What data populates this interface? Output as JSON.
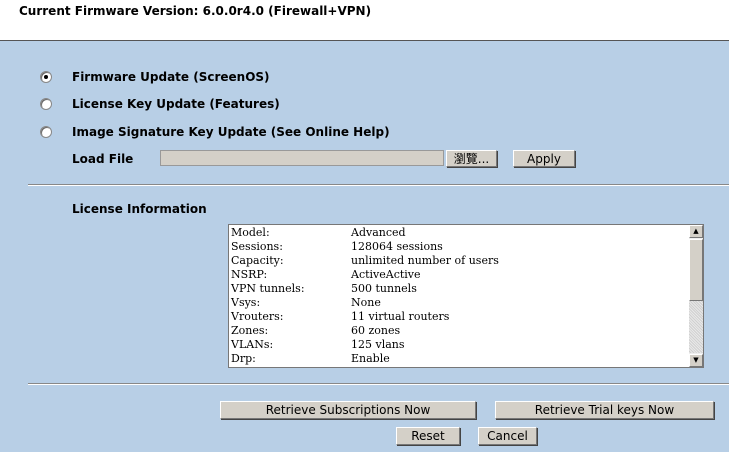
{
  "header": {
    "title": "Current Firmware Version: 6.0.0r4.0 (Firewall+VPN)"
  },
  "update_options": [
    {
      "label": "Firmware Update (ScreenOS)",
      "selected": true
    },
    {
      "label": "License Key Update (Features)",
      "selected": false
    },
    {
      "label": "Image Signature Key Update (See Online Help)",
      "selected": false
    }
  ],
  "load_file": {
    "label": "Load File",
    "value": "",
    "browse_label": "瀏覽...",
    "apply_label": "Apply"
  },
  "license_info": {
    "label": "License Information",
    "rows": [
      {
        "key": "Model:",
        "value": "Advanced"
      },
      {
        "key": "Sessions:",
        "value": "128064 sessions"
      },
      {
        "key": "Capacity:",
        "value": "unlimited number of users"
      },
      {
        "key": "NSRP:",
        "value": "ActiveActive"
      },
      {
        "key": "VPN tunnels:",
        "value": "500 tunnels"
      },
      {
        "key": "Vsys:",
        "value": "None"
      },
      {
        "key": "Vrouters:",
        "value": "11 virtual routers"
      },
      {
        "key": "Zones:",
        "value": "60 zones"
      },
      {
        "key": "VLANs:",
        "value": "125 vlans"
      },
      {
        "key": "Drp:",
        "value": "Enable"
      }
    ]
  },
  "actions": {
    "retrieve_subscriptions": "Retrieve Subscriptions Now",
    "retrieve_trial": "Retrieve Trial keys Now",
    "reset": "Reset",
    "cancel": "Cancel"
  },
  "colors": {
    "panel_bg": "#b8cfe6",
    "button_bg": "#d4d0c8"
  }
}
